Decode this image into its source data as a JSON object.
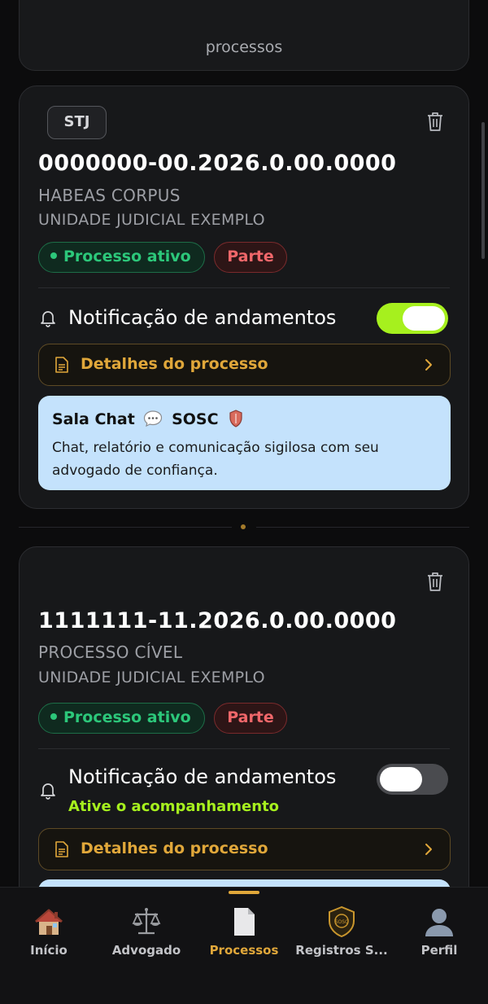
{
  "top_card": {
    "text": "processos"
  },
  "processes": [
    {
      "court": "STJ",
      "number": "0000000-00.2026.0.00.0000",
      "type": "HABEAS CORPUS",
      "unit": "UNIDADE JUDICIAL EXEMPLO",
      "status_tag": "Processo ativo",
      "role_tag": "Parte",
      "notification_label": "Notificação de andamentos",
      "notification_on": true,
      "details_label": "Detalhes do processo",
      "chat": {
        "title_prefix": "Sala Chat",
        "title_suffix": "SOSC",
        "description": "Chat, relatório e comunicação sigilosa com seu advogado de confiança."
      }
    },
    {
      "number": "1111111-11.2026.0.00.0000",
      "type": "PROCESSO CÍVEL",
      "unit": "UNIDADE JUDICIAL EXEMPLO",
      "status_tag": "Processo ativo",
      "role_tag": "Parte",
      "notification_label": "Notificação de andamentos",
      "notification_sub": "Ative o acompanhamento",
      "notification_on": false,
      "details_label": "Detalhes do processo"
    }
  ],
  "tabs": [
    {
      "label": "Início",
      "icon": "house-icon"
    },
    {
      "label": "Advogado",
      "icon": "scales-icon"
    },
    {
      "label": "Processos",
      "icon": "document-icon",
      "active": true
    },
    {
      "label": "Registros S...",
      "icon": "sosc-badge-icon"
    },
    {
      "label": "Perfil",
      "icon": "user-icon"
    }
  ],
  "colors": {
    "accent": "#e0a73a",
    "toggle_on": "#a6f01e",
    "active_green": "#2cc77a",
    "party_red": "#f0676a",
    "chat_bg": "#c4e2fc"
  }
}
